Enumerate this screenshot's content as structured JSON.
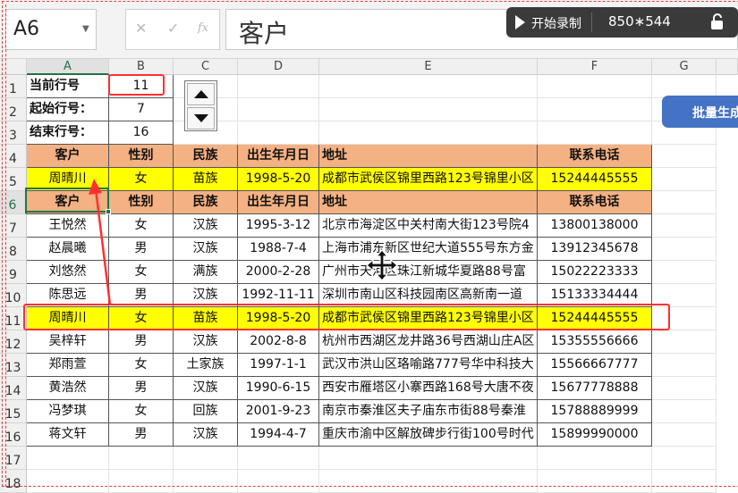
{
  "formula_bar": {
    "name_box": "A6",
    "cancel_icon": "✕",
    "enter_icon": "✓",
    "fx_label": "fx",
    "content": "客户"
  },
  "recorder": {
    "record_label": "开始录制",
    "size": "850∗544"
  },
  "columns": [
    "A",
    "B",
    "C",
    "D",
    "E",
    "F",
    "G"
  ],
  "rows": [
    "1",
    "2",
    "3",
    "4",
    "5",
    "6",
    "7",
    "8",
    "9",
    "10",
    "11",
    "12",
    "13",
    "14",
    "15",
    "16",
    "17",
    "18"
  ],
  "params": [
    {
      "label": "当前行号",
      "value": "11"
    },
    {
      "label": "起始行号：",
      "value": "7"
    },
    {
      "label": "结束行号：",
      "value": "16"
    }
  ],
  "table_header": [
    "客户",
    "性别",
    "民族",
    "出生年月日",
    "地址",
    "联系电话"
  ],
  "current_record": [
    "周晴川",
    "女",
    "苗族",
    "1998-5-20",
    "成都市武侯区锦里西路123号锦里小区",
    "15244445555"
  ],
  "records": [
    [
      "王悦然",
      "女",
      "汉族",
      "1995-3-12",
      "北京市海淀区中关村南大街123号院4",
      "13800138000"
    ],
    [
      "赵晨曦",
      "男",
      "汉族",
      "1988-7-4",
      "上海市浦东新区世纪大道555号东方金",
      "13912345678"
    ],
    [
      "刘悠然",
      "女",
      "满族",
      "2000-2-28",
      "广州市天河区珠江新城华夏路88号富",
      "15022223333"
    ],
    [
      "陈思远",
      "男",
      "汉族",
      "1992-11-11",
      "深圳市南山区科技园南区高新南一道",
      "15133334444"
    ],
    [
      "周晴川",
      "女",
      "苗族",
      "1998-5-20",
      "成都市武侯区锦里西路123号锦里小区",
      "15244445555"
    ],
    [
      "吴梓轩",
      "男",
      "汉族",
      "2002-8-8",
      "杭州市西湖区龙井路36号西湖山庄A区",
      "15355556666"
    ],
    [
      "郑雨萱",
      "女",
      "土家族",
      "1997-1-1",
      "武汉市洪山区珞喻路777号华中科技大",
      "15566667777"
    ],
    [
      "黄浩然",
      "男",
      "汉族",
      "1990-6-15",
      "西安市雁塔区小寨西路168号大唐不夜",
      "15677778888"
    ],
    [
      "冯梦琪",
      "女",
      "回族",
      "2001-9-23",
      "南京市秦淮区夫子庙东市街88号秦淮",
      "15788889999"
    ],
    [
      "蒋文轩",
      "男",
      "汉族",
      "1994-4-7",
      "重庆市渝中区解放碑步行街100号时代",
      "15899990000"
    ]
  ],
  "batch_button": "批量生成",
  "colors": {
    "header_fill": "#f4b183",
    "highlight_fill": "#ffff00",
    "button": "#4472c4",
    "annotation": "#ff3030"
  }
}
